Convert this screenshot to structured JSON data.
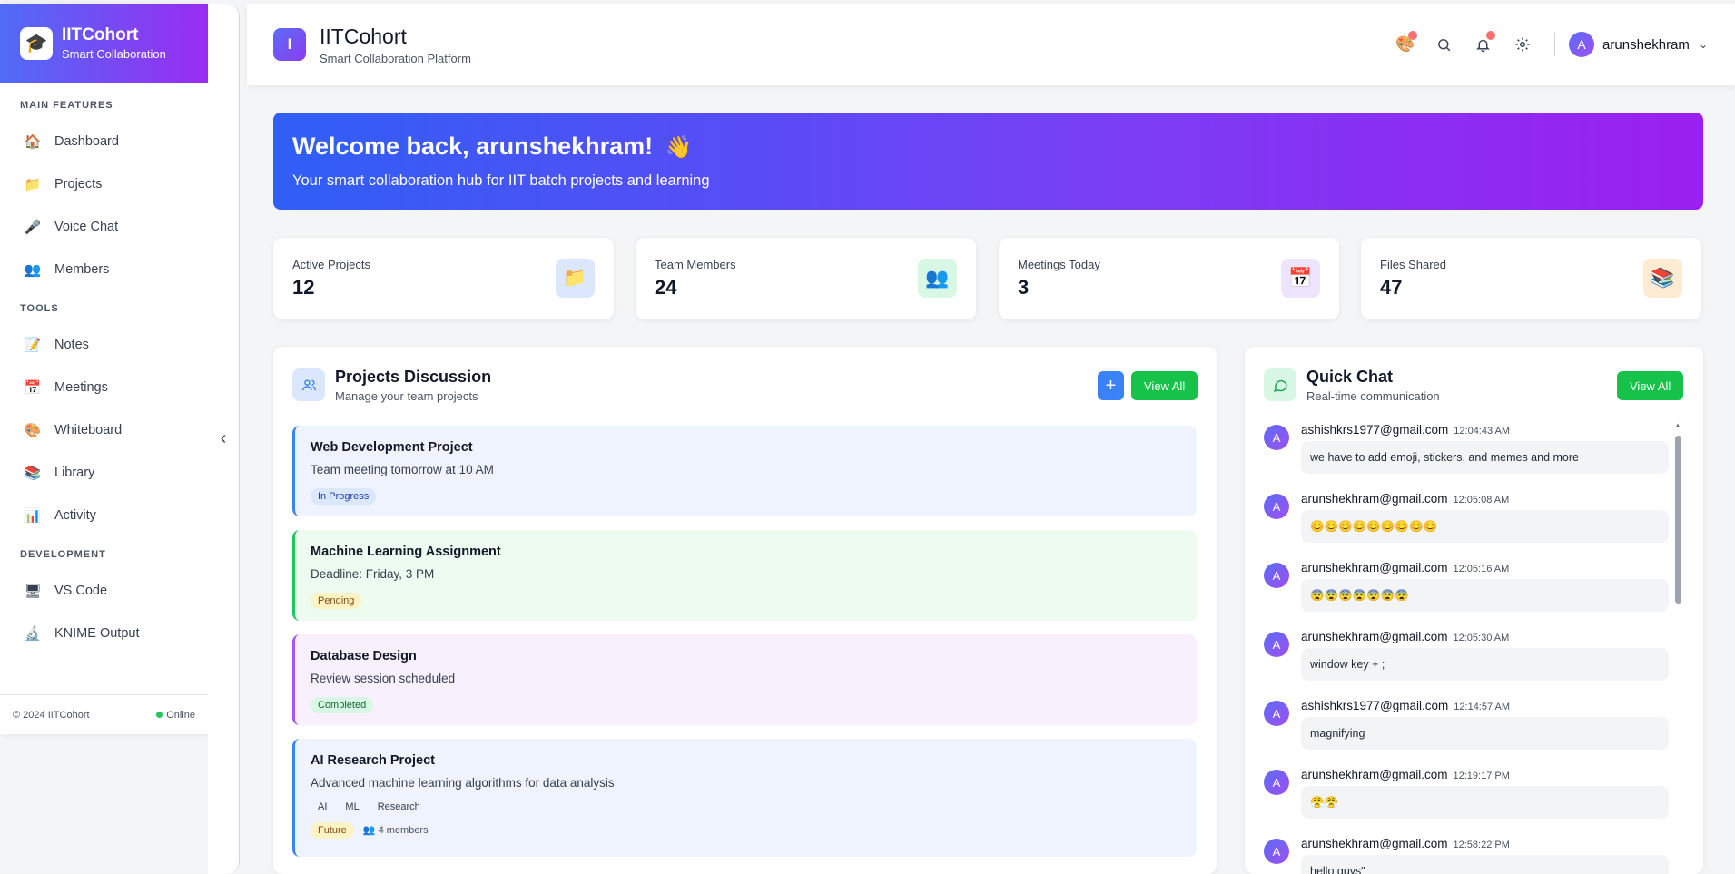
{
  "sidebar": {
    "brand_title": "IITCohort",
    "brand_sub": "Smart Collaboration",
    "sections": [
      {
        "title": "MAIN FEATURES",
        "items": [
          {
            "label": "Dashboard",
            "icon": "house-icon",
            "glyph": "🏠"
          },
          {
            "label": "Projects",
            "icon": "folder-icon",
            "glyph": "📁"
          },
          {
            "label": "Voice Chat",
            "icon": "microphone-icon",
            "glyph": "🎤"
          },
          {
            "label": "Members",
            "icon": "people-icon",
            "glyph": "👥"
          }
        ]
      },
      {
        "title": "TOOLS",
        "items": [
          {
            "label": "Notes",
            "icon": "memo-icon",
            "glyph": "📝"
          },
          {
            "label": "Meetings",
            "icon": "calendar-icon",
            "glyph": "📅"
          },
          {
            "label": "Whiteboard",
            "icon": "palette-icon",
            "glyph": "🎨"
          },
          {
            "label": "Library",
            "icon": "books-icon",
            "glyph": "📚"
          },
          {
            "label": "Activity",
            "icon": "chart-icon",
            "glyph": "📊"
          }
        ]
      },
      {
        "title": "DEVELOPMENT",
        "items": [
          {
            "label": "VS Code",
            "icon": "computer-icon",
            "glyph": "🖥"
          },
          {
            "label": "KNIME Output",
            "icon": "microscope-icon",
            "glyph": "🔬"
          }
        ]
      }
    ],
    "footer_copyright": "© 2024 IITCohort",
    "footer_status": "Online"
  },
  "topbar": {
    "logo_letter": "I",
    "title": "IITCohort",
    "subtitle": "Smart Collaboration Platform",
    "user_initial": "A",
    "user_name": "arunshekhram"
  },
  "welcome": {
    "title": "Welcome back, arunshekhram!",
    "emoji": "👋",
    "subtitle": "Your smart collaboration hub for IIT batch projects and learning"
  },
  "stats": [
    {
      "label": "Active Projects",
      "value": "12",
      "icon": "folder-icon",
      "glyph": "📁",
      "bg": "#dbe7fd"
    },
    {
      "label": "Team Members",
      "value": "24",
      "icon": "people-icon",
      "glyph": "👥",
      "bg": "#d9f7e5"
    },
    {
      "label": "Meetings Today",
      "value": "3",
      "icon": "calendar-icon",
      "glyph": "📅",
      "bg": "#efe4fd"
    },
    {
      "label": "Files Shared",
      "value": "47",
      "icon": "books-icon",
      "glyph": "📚",
      "bg": "#fdebd3"
    }
  ],
  "projects_panel": {
    "title": "Projects Discussion",
    "subtitle": "Manage your team projects",
    "add_label": "+",
    "view_all": "View All",
    "projects": [
      {
        "title": "Web Development Project",
        "desc": "Team meeting tomorrow at 10 AM",
        "status": "In Progress",
        "bg": "#eef3fd",
        "border": "#3b82f6",
        "badge_bg": "#dbe7fd",
        "badge_fg": "#1e40af"
      },
      {
        "title": "Machine Learning Assignment",
        "desc": "Deadline: Friday, 3 PM",
        "status": "Pending",
        "bg": "#edfbf1",
        "border": "#22c55e",
        "badge_bg": "#fdf3c4",
        "badge_fg": "#854d0e"
      },
      {
        "title": "Database Design",
        "desc": "Review session scheduled",
        "status": "Completed",
        "bg": "#f8f1fd",
        "border": "#a855f7",
        "badge_bg": "#d9f7e5",
        "badge_fg": "#166534"
      },
      {
        "title": "AI Research Project",
        "desc": "Advanced machine learning algorithms for data analysis",
        "tags": [
          "AI",
          "ML",
          "Research"
        ],
        "status": "Future",
        "members": "4 members",
        "bg": "#eef3fd",
        "border": "#3b82f6",
        "badge_bg": "#fdf3c4",
        "badge_fg": "#854d0e"
      }
    ]
  },
  "chat_panel": {
    "title": "Quick Chat",
    "subtitle": "Real-time communication",
    "view_all": "View All",
    "messages": [
      {
        "user": "ashishkrs1977@gmail.com",
        "time": "12:04:43 AM",
        "text": "we have to add emoji, stickers, and memes and more"
      },
      {
        "user": "arunshekhram@gmail.com",
        "time": "12:05:08 AM",
        "text": "😊😊😊😊😊😊😊😊😊"
      },
      {
        "user": "arunshekhram@gmail.com",
        "time": "12:05:16 AM",
        "text": "😨😨😨😨😨😨😨"
      },
      {
        "user": "arunshekhram@gmail.com",
        "time": "12:05:30 AM",
        "text": "window key + ;"
      },
      {
        "user": "ashishkrs1977@gmail.com",
        "time": "12:14:57 AM",
        "text": "magnifying"
      },
      {
        "user": "arunshekhram@gmail.com",
        "time": "12:19:17 PM",
        "text": "😤😤"
      },
      {
        "user": "arunshekhram@gmail.com",
        "time": "12:58:22 PM",
        "text": "hello guys\""
      }
    ]
  }
}
